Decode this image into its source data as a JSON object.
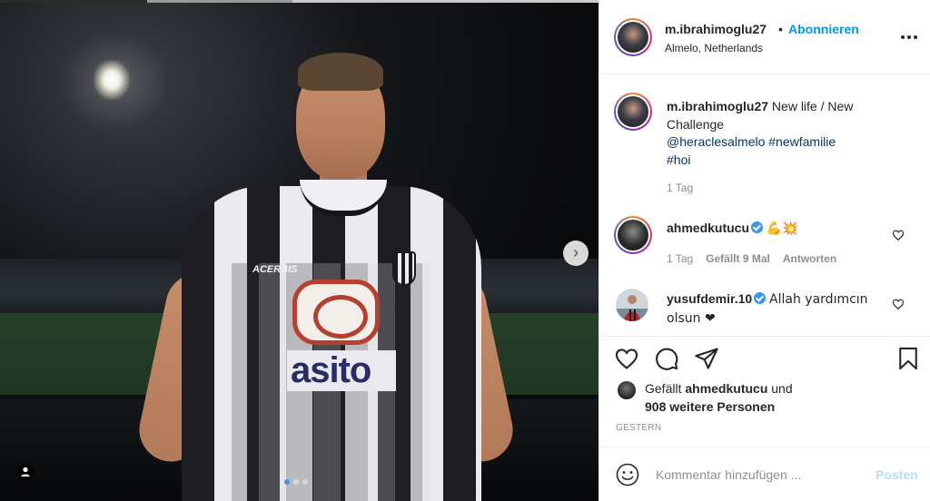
{
  "post": {
    "author": "m.ibrahimoglu27",
    "follow_label": "Abonnieren",
    "bullet": "•",
    "location": "Almelo, Netherlands",
    "photo": {
      "brand": "ACERBIS",
      "sponsor": "asito",
      "slide_count": 3,
      "active_slide": 1
    }
  },
  "caption": {
    "author": "m.ibrahimoglu27",
    "text": "New life / New Challenge",
    "tags_line1": "@heraclesalmelo #newfamilie",
    "tags_line2": "#hoi",
    "time": "1 Tag"
  },
  "comments": [
    {
      "author": "ahmedkutucu",
      "verified": true,
      "text": "💪💥",
      "time": "1 Tag",
      "likes": "Gefällt 9 Mal",
      "reply": "Antworten"
    },
    {
      "author": "yusufdemir.10",
      "verified": true,
      "text": "Allah yardımcın olsun ❤"
    }
  ],
  "likes": {
    "prefix": "Gefällt ",
    "user": "ahmedkutucu",
    "mid": " und",
    "others": "908 weitere Personen"
  },
  "date": "GESTERN",
  "composer": {
    "placeholder": "Kommentar hinzufügen ...",
    "post_label": "Posten"
  },
  "colors": {
    "link": "#00376b",
    "accent": "#0095f6",
    "muted": "#8e8e8e",
    "post_disabled": "#b2dffc"
  },
  "icons": [
    "more-icon",
    "heart-icon",
    "comment-icon",
    "share-icon",
    "bookmark-icon",
    "smiley-icon",
    "next-arrow-icon",
    "user-tag-icon",
    "verified-icon"
  ]
}
